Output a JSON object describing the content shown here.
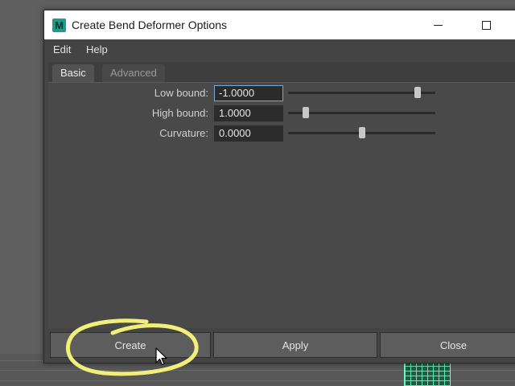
{
  "window": {
    "title": "Create Bend Deformer Options",
    "app_icon_letter": "M"
  },
  "menu": {
    "items": [
      "Edit",
      "Help"
    ]
  },
  "tabs": [
    {
      "label": "Basic",
      "active": true
    },
    {
      "label": "Advanced",
      "active": false
    }
  ],
  "fields": [
    {
      "label": "Low bound:",
      "value": "-1.0000",
      "slider_fraction": 0.88
    },
    {
      "label": "High bound:",
      "value": "1.0000",
      "slider_fraction": 0.12
    },
    {
      "label": "Curvature:",
      "value": "0.0000",
      "slider_fraction": 0.5
    }
  ],
  "buttons": {
    "create": "Create",
    "apply": "Apply",
    "close": "Close"
  },
  "colors": {
    "accent_focus": "#7aa7d6",
    "annotation": "#f2ee7a",
    "mesh": "#5affbe"
  },
  "icons": {
    "app": "maya-logo-icon",
    "minimize": "minimize-icon",
    "maximize": "maximize-icon",
    "cursor": "mouse-pointer-icon"
  }
}
